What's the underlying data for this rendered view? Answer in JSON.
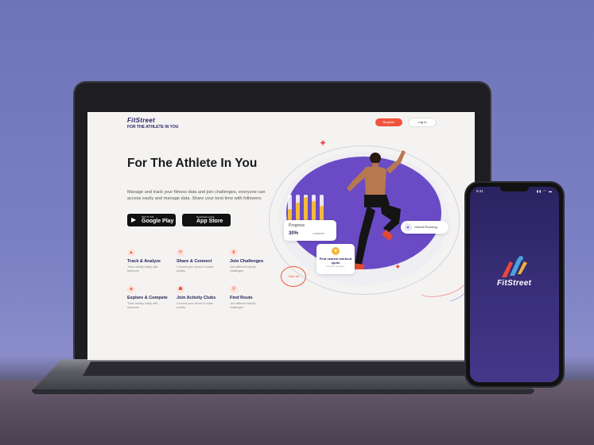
{
  "site": {
    "logo_line1": "FitStreet",
    "logo_line2": "FOR THE ATHLETE IN YOU",
    "register_label": "Register",
    "login_label": "Log In",
    "hero_title": "For The Athlete In You",
    "hero_subtitle": "Manage and track your fitness data and join challenges, everyone can access easily and manage data. Share your best time with followers.",
    "google_play": {
      "small": "GET IT ON",
      "large": "Google Play",
      "icon": "play-icon"
    },
    "app_store": {
      "small": "Download on the",
      "large": "App Store",
      "icon": "apple-icon"
    },
    "features": [
      {
        "title": "Track & Analyze",
        "desc": "Track activity easily with teamcore",
        "icon": "chart-icon"
      },
      {
        "title": "Share & Connect",
        "desc": "Connect your device & share activity",
        "icon": "share-icon"
      },
      {
        "title": "Join Challenges",
        "desc": "Join different activity challenges",
        "icon": "trophy-icon"
      },
      {
        "title": "Explore & Compete",
        "desc": "Track activity easily with teamcore",
        "icon": "compass-icon"
      },
      {
        "title": "Join Activity Clubs",
        "desc": "Connect your device & share activity",
        "icon": "club-icon"
      },
      {
        "title": "Find Routs",
        "desc": "Join different activity challenges",
        "icon": "pin-icon"
      }
    ],
    "progress": {
      "label": "Progress",
      "value": "30%",
      "sub": "Lastweek",
      "levels": [
        0.45,
        0.7,
        0.9,
        0.75,
        0.55
      ]
    },
    "run_tag": "Overall Running",
    "gym_card": {
      "title": "Find nearest workout spots",
      "sub": "Get who you place"
    },
    "view_all": "View all"
  },
  "phone": {
    "time": "9:41",
    "status": "▮▮ ◠ ▬",
    "logo": "FitStreet"
  },
  "colors": {
    "accent": "#f0543c",
    "brand_purple": "#6a4bc5",
    "navy": "#1f1f55",
    "bar_yellow": "#f6b93b"
  }
}
